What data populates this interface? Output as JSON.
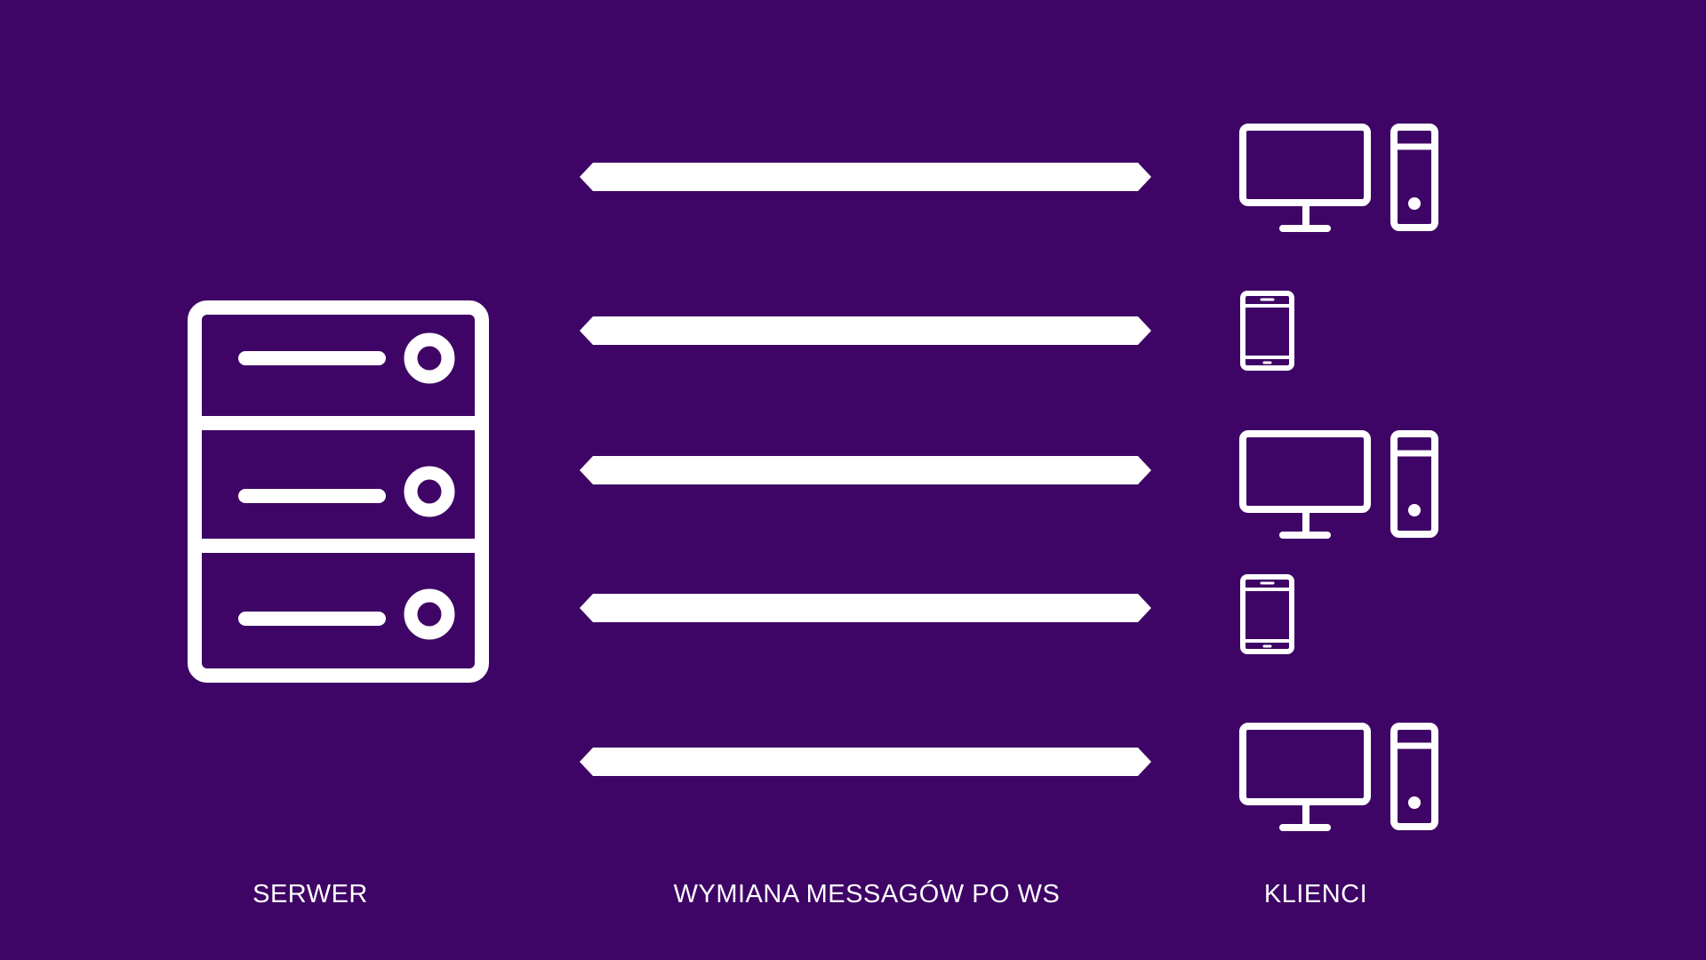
{
  "labels": {
    "server": "SERWER",
    "exchange": "WYMIANA MESSAGÓW PO WS",
    "clients": "KLIENCI"
  },
  "colors": {
    "background": "#3e0566",
    "foreground": "#ffffff"
  },
  "icons": {
    "server": "server-rack-icon",
    "desktop": "desktop-computer-icon",
    "tablet": "tablet-icon",
    "arrow": "double-arrow-icon"
  },
  "clients": [
    {
      "type": "desktop"
    },
    {
      "type": "tablet"
    },
    {
      "type": "desktop"
    },
    {
      "type": "tablet"
    },
    {
      "type": "desktop"
    }
  ]
}
